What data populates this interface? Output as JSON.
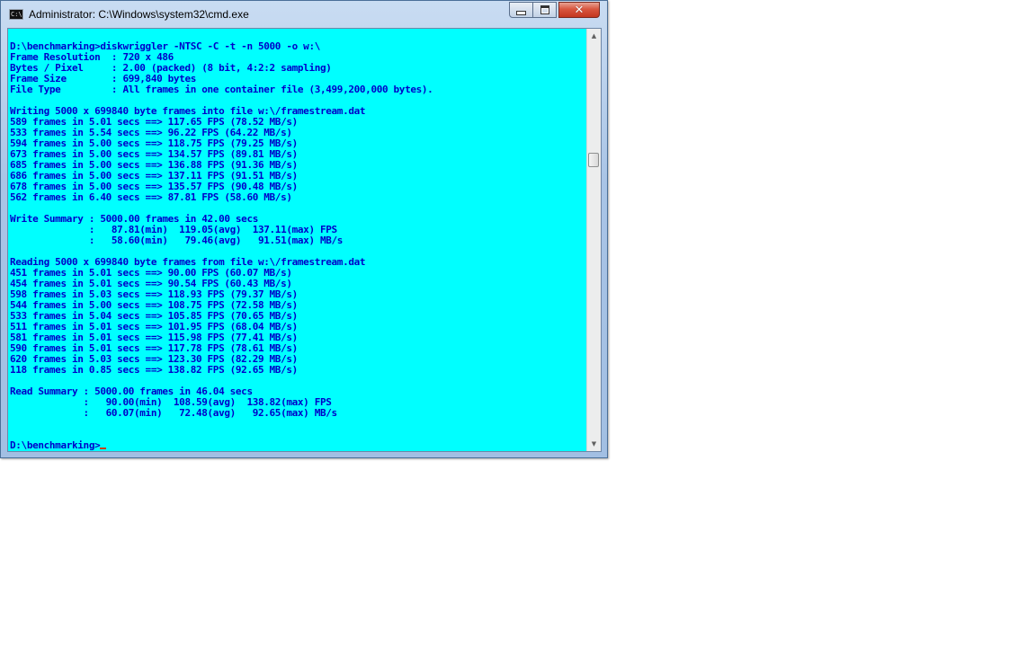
{
  "window": {
    "title": "Administrator: C:\\Windows\\system32\\cmd.exe",
    "icon_label": "C:\\",
    "close_glyph": "✕"
  },
  "console": {
    "lines": [
      "D:\\benchmarking>diskwriggler -NTSC -C -t -n 5000 -o w:\\",
      "Frame Resolution  : 720 x 486",
      "Bytes / Pixel     : 2.00 (packed) (8 bit, 4:2:2 sampling)",
      "Frame Size        : 699,840 bytes",
      "File Type         : All frames in one container file (3,499,200,000 bytes).",
      "",
      "Writing 5000 x 699840 byte frames into file w:\\/framestream.dat",
      "589 frames in 5.01 secs ==> 117.65 FPS (78.52 MB/s)",
      "533 frames in 5.54 secs ==> 96.22 FPS (64.22 MB/s)",
      "594 frames in 5.00 secs ==> 118.75 FPS (79.25 MB/s)",
      "673 frames in 5.00 secs ==> 134.57 FPS (89.81 MB/s)",
      "685 frames in 5.00 secs ==> 136.88 FPS (91.36 MB/s)",
      "686 frames in 5.00 secs ==> 137.11 FPS (91.51 MB/s)",
      "678 frames in 5.00 secs ==> 135.57 FPS (90.48 MB/s)",
      "562 frames in 6.40 secs ==> 87.81 FPS (58.60 MB/s)",
      "",
      "Write Summary : 5000.00 frames in 42.00 secs",
      "              :   87.81(min)  119.05(avg)  137.11(max) FPS",
      "              :   58.60(min)   79.46(avg)   91.51(max) MB/s",
      "",
      "Reading 5000 x 699840 byte frames from file w:\\/framestream.dat",
      "451 frames in 5.01 secs ==> 90.00 FPS (60.07 MB/s)",
      "454 frames in 5.01 secs ==> 90.54 FPS (60.43 MB/s)",
      "598 frames in 5.03 secs ==> 118.93 FPS (79.37 MB/s)",
      "544 frames in 5.00 secs ==> 108.75 FPS (72.58 MB/s)",
      "533 frames in 5.04 secs ==> 105.85 FPS (70.65 MB/s)",
      "511 frames in 5.01 secs ==> 101.95 FPS (68.04 MB/s)",
      "581 frames in 5.01 secs ==> 115.98 FPS (77.41 MB/s)",
      "590 frames in 5.01 secs ==> 117.78 FPS (78.61 MB/s)",
      "620 frames in 5.03 secs ==> 123.30 FPS (82.29 MB/s)",
      "118 frames in 0.85 secs ==> 138.82 FPS (92.65 MB/s)",
      "",
      "Read Summary : 5000.00 frames in 46.04 secs",
      "             :   90.00(min)  108.59(avg)  138.82(max) FPS",
      "             :   60.07(min)   72.48(avg)   92.65(max) MB/s",
      "",
      "",
      "D:\\benchmarking>"
    ]
  },
  "colors": {
    "console_background": "#00ffff",
    "console_text": "#0000c8",
    "cursor": "#c8400a",
    "close_button": "#c3371f"
  },
  "icons": {
    "minimize": "minimize-icon",
    "maximize": "maximize-icon",
    "close": "close-icon",
    "scroll_up": "scroll-up-arrow-icon",
    "scroll_down": "scroll-down-arrow-icon"
  }
}
